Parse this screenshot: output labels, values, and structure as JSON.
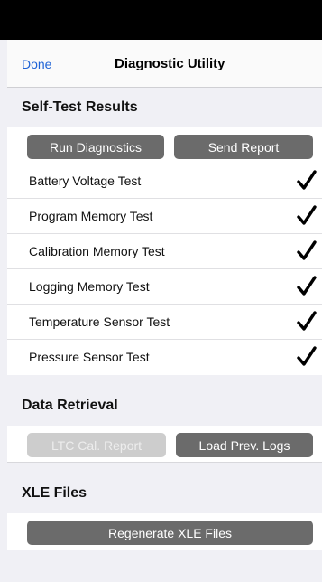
{
  "nav": {
    "done_label": "Done",
    "title": "Diagnostic Utility"
  },
  "self_test": {
    "header": "Self-Test Results",
    "run_label": "Run Diagnostics",
    "send_label": "Send Report",
    "tests": [
      {
        "label": "Battery Voltage Test",
        "passed": true
      },
      {
        "label": "Program Memory Test",
        "passed": true
      },
      {
        "label": "Calibration Memory Test",
        "passed": true
      },
      {
        "label": "Logging Memory Test",
        "passed": true
      },
      {
        "label": "Temperature Sensor Test",
        "passed": true
      },
      {
        "label": "Pressure Sensor Test",
        "passed": true
      }
    ]
  },
  "data_retrieval": {
    "header": "Data Retrieval",
    "ltc_label": "LTC Cal. Report",
    "load_label": "Load Prev. Logs"
  },
  "xle": {
    "header": "XLE Files",
    "regen_label": "Regenerate XLE Files"
  },
  "icons": {
    "check": "checkmark-icon"
  },
  "colors": {
    "accent": "#1e63d6",
    "button": "#6b6b6b",
    "button_disabled": "#cdcdcd"
  }
}
